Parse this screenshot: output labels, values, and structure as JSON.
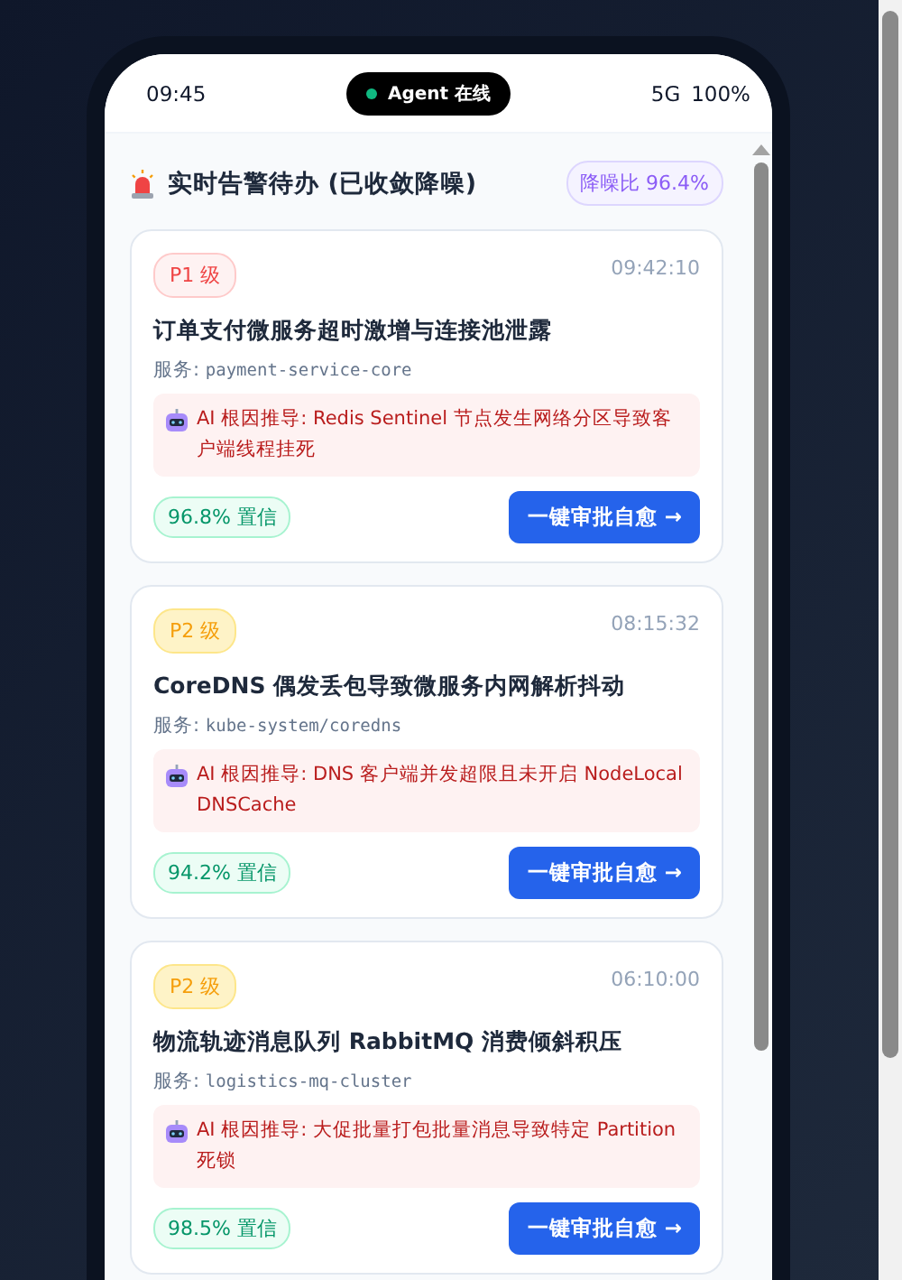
{
  "status_bar": {
    "time": "09:45",
    "agent_status": "Agent 在线",
    "online": true,
    "network": "5G",
    "battery": "100%"
  },
  "header": {
    "title": "实时告警待办 (已收敛降噪)",
    "noise_ratio": "降噪比 96.4%"
  },
  "alerts": [
    {
      "kind": "p1",
      "level_label": "P1 级",
      "time": "09:42:10",
      "title": "订单支付微服务超时激增与连接池泄露",
      "service_label": "服务:",
      "service": "payment-service-core",
      "root_cause": "AI 根因推导: Redis Sentinel 节点发生网络分区导致客户端线程挂死",
      "confidence": "96.8% 置信",
      "action": "一键审批自愈 →"
    },
    {
      "kind": "p2",
      "level_label": "P2 级",
      "time": "08:15:32",
      "title": "CoreDNS 偶发丢包导致微服务内网解析抖动",
      "service_label": "服务:",
      "service": "kube-system/coredns",
      "root_cause": "AI 根因推导: DNS 客户端并发超限且未开启 NodeLocal DNSCache",
      "confidence": "94.2% 置信",
      "action": "一键审批自愈 →"
    },
    {
      "kind": "p2",
      "level_label": "P2 级",
      "time": "06:10:00",
      "title": "物流轨迹消息队列 RabbitMQ 消费倾斜积压",
      "service_label": "服务:",
      "service": "logistics-mq-cluster",
      "root_cause": "AI 根因推导: 大促批量打包批量消息导致特定 Partition 死锁",
      "confidence": "98.5% 置信",
      "action": "一键审批自愈 →"
    }
  ]
}
